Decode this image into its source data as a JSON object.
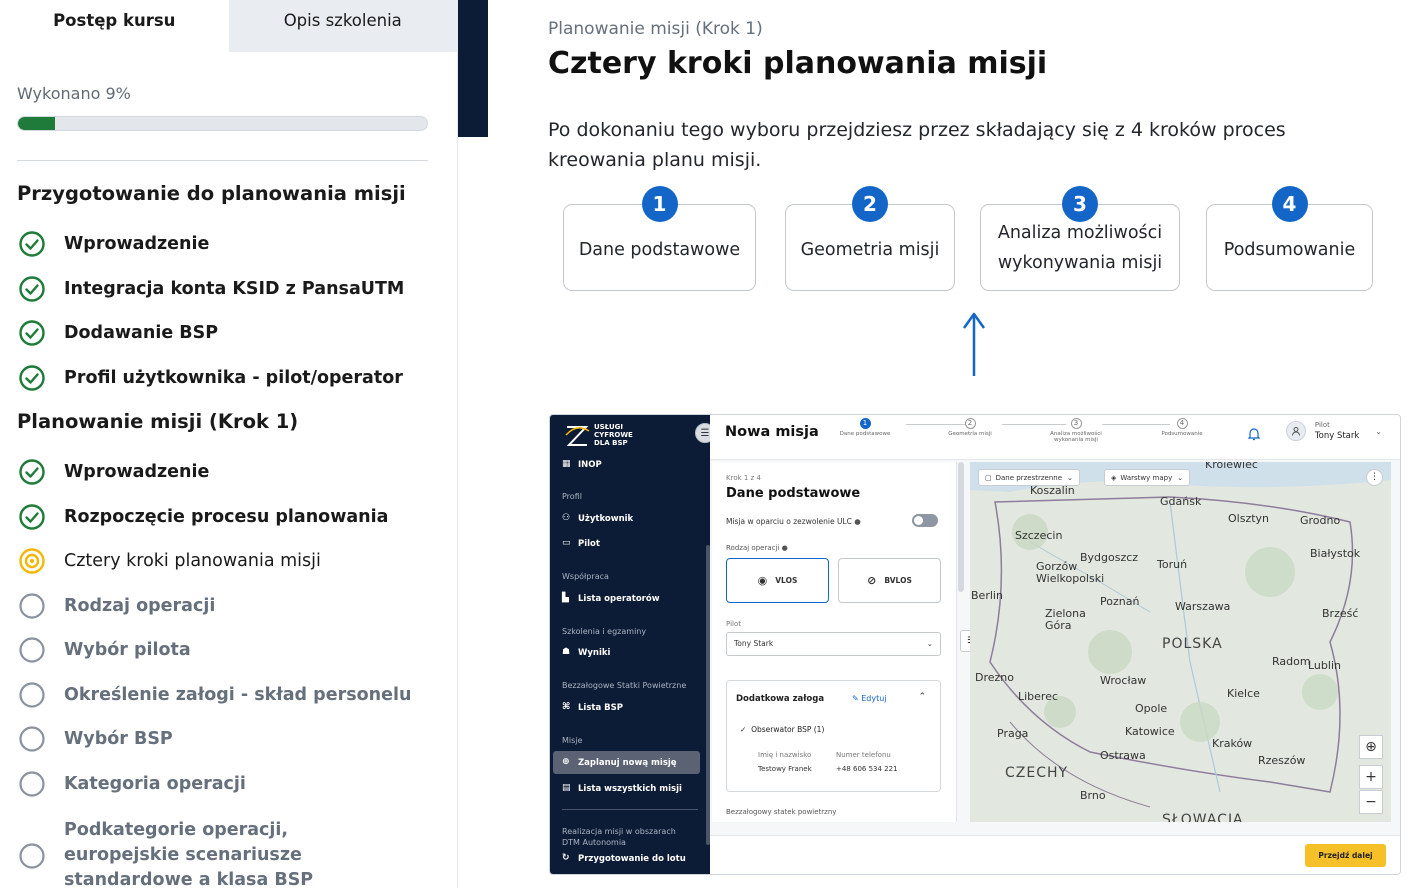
{
  "sidebar": {
    "tabs": [
      "Postęp kursu",
      "Opis szkolenia"
    ],
    "progress_label": "Wykonano 9%",
    "progress_fraction": 0.09,
    "sections": [
      {
        "title": "Przygotowanie do planowania misji",
        "items": [
          {
            "label": "Wprowadzenie",
            "status": "done"
          },
          {
            "label": "Integracja konta KSID z PansaUTM",
            "status": "done"
          },
          {
            "label": "Dodawanie BSP",
            "status": "done"
          },
          {
            "label": "Profil użytkownika - pilot/operator",
            "status": "done"
          }
        ]
      },
      {
        "title": "Planowanie misji (Krok 1)",
        "items": [
          {
            "label": "Wprowadzenie",
            "status": "done"
          },
          {
            "label": "Rozpoczęcie procesu planowania",
            "status": "done"
          },
          {
            "label": "Cztery kroki planowania misji",
            "status": "current"
          },
          {
            "label": "Rodzaj operacji",
            "status": "todo"
          },
          {
            "label": "Wybór pilota",
            "status": "todo"
          },
          {
            "label": "Określenie załogi - skład personelu",
            "status": "todo"
          },
          {
            "label": "Wybór BSP",
            "status": "todo"
          },
          {
            "label": "Kategoria operacji",
            "status": "todo"
          },
          {
            "label": "Podkategorie operacji, europejskie scenariusze standardowe a klasa BSP",
            "status": "todo"
          }
        ]
      }
    ]
  },
  "main": {
    "breadcrumb": "Planowanie misji (Krok 1)",
    "title": "Cztery kroki planowania misji",
    "description": "Po dokonaniu tego wyboru przejdziesz przez składający się z 4 kroków proces kreowania planu misji.",
    "steps": [
      {
        "num": "1",
        "label": "Dane podstawowe"
      },
      {
        "num": "2",
        "label": "Geometria misji"
      },
      {
        "num": "3",
        "label": "Analiza możliwości wykonywania misji"
      },
      {
        "num": "4",
        "label": "Podsumowanie"
      }
    ]
  },
  "screenshot": {
    "logo_text": [
      "USŁUGI",
      "CYFROWE",
      "DLA BSP"
    ],
    "nav": [
      {
        "type": "item",
        "label": "INOP"
      },
      {
        "type": "head",
        "label": "Profil"
      },
      {
        "type": "item",
        "label": "Użytkownik"
      },
      {
        "type": "item",
        "label": "Pilot"
      },
      {
        "type": "head",
        "label": "Współpraca"
      },
      {
        "type": "item",
        "label": "Lista operatorów"
      },
      {
        "type": "head",
        "label": "Szkolenia i egzaminy"
      },
      {
        "type": "item",
        "label": "Wyniki"
      },
      {
        "type": "head",
        "label": "Bezzałogowe Statki Powietrzne"
      },
      {
        "type": "item",
        "label": "Lista BSP"
      },
      {
        "type": "head",
        "label": "Misje"
      },
      {
        "type": "item",
        "label": "Zaplanuj nową misję",
        "selected": true
      },
      {
        "type": "item",
        "label": "Lista wszystkich misji"
      },
      {
        "type": "head",
        "label": "Realizacja misji w obszarach DTM Autonomia"
      },
      {
        "type": "item",
        "label": "Przygotowanie do lotu"
      }
    ],
    "page_title": "Nowa misja",
    "wizard": [
      "Dane podstawowe",
      "Geometria misji",
      "Analiza możliwości wykonania misji",
      "Podsumowanie"
    ],
    "user": {
      "role": "Pilot",
      "name": "Tony Stark"
    },
    "form": {
      "step": "Krok 1 z 4",
      "title": "Dane podstawowe",
      "ulc_label": "Misja w oparciu o zezwolenie ULC",
      "op_label": "Rodzaj operacji",
      "vlos": "VLOS",
      "bvlos": "BVLOS",
      "pilot_label": "Pilot",
      "pilot_value": "Tony Stark",
      "crew_title": "Dodatkowa załoga",
      "crew_edit": "Edytuj",
      "crew_member": "Obserwator BSP (1)",
      "name_label": "Imię i nazwisko",
      "phone_label": "Numer telefonu",
      "name_value": "Testowy Franek",
      "phone_value": "+48 606 534 221",
      "uav_label": "Bezzałogowy statek powietrzny"
    },
    "map": {
      "space_btn": "Dane przestrzenne",
      "layers_btn": "Warstwy mapy",
      "cities": [
        "Krolewiec",
        "Koszalin",
        "Gdańsk",
        "Olsztyn",
        "Grodno",
        "Szczecin",
        "Bydgoszcz",
        "Toruń",
        "Białystok",
        "Gorzów Wielkopolski",
        "Poznań",
        "Berlin",
        "Warszawa",
        "Brześć",
        "Zielona Góra",
        "POLSKA",
        "Radom",
        "Lublin",
        "Drezno",
        "Wrocław",
        "Liberec",
        "Kielce",
        "Opole",
        "Praga",
        "Katowice",
        "Kraków",
        "Ostrawa",
        "Rzeszów",
        "CZECHY",
        "Brno",
        "SŁOWACJA"
      ]
    },
    "next_btn": "Przejdź dalej"
  },
  "colors": {
    "accent": "#1366c7",
    "done": "#1e7b39",
    "current": "#f2b807",
    "todo": "#8a929e",
    "navy": "#0d1c36"
  }
}
